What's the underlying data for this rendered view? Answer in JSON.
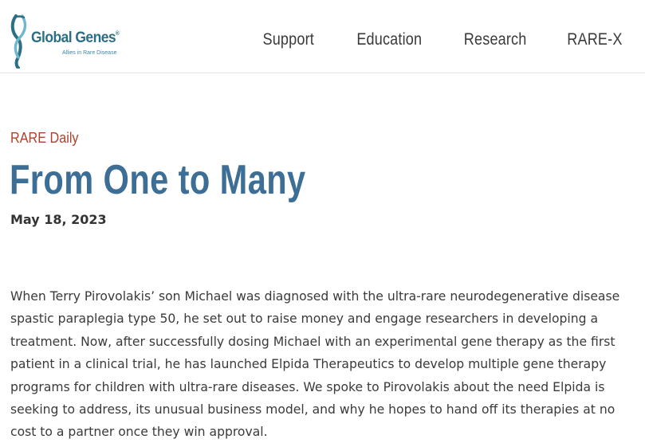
{
  "header": {
    "logo": {
      "name": "Global Genes",
      "registered_mark": "®",
      "tagline": "Allies in Rare Disease",
      "color": "#2b6f86"
    },
    "nav": [
      {
        "label": "Support"
      },
      {
        "label": "Education"
      },
      {
        "label": "Research"
      },
      {
        "label": "RARE-X"
      }
    ]
  },
  "article": {
    "category": "RARE Daily",
    "title": "From One to Many",
    "date": "May 18, 2023",
    "body": "When Terry Pirovolakis’ son Michael was diagnosed with the ultra-rare neurodegenerative disease spastic paraplegia type 50, he set out to raise money and engage researchers in developing a treatment. Now, after successfully dosing Michael with an experimental gene therapy as the first patient in a clinical trial, he has launched Elpida Therapeutics to develop multiple gene therapy programs for children with ultra-rare diseases. We spoke to Pirovolakis about the need Elpida is seeking to address, its unusual business model, and why he hopes to hand off its therapies at no cost to a partner once they win approval."
  },
  "colors": {
    "category": "#b0412c",
    "title": "#3d6f96",
    "text": "#3a3a3a",
    "divider": "#e4e4e4"
  }
}
